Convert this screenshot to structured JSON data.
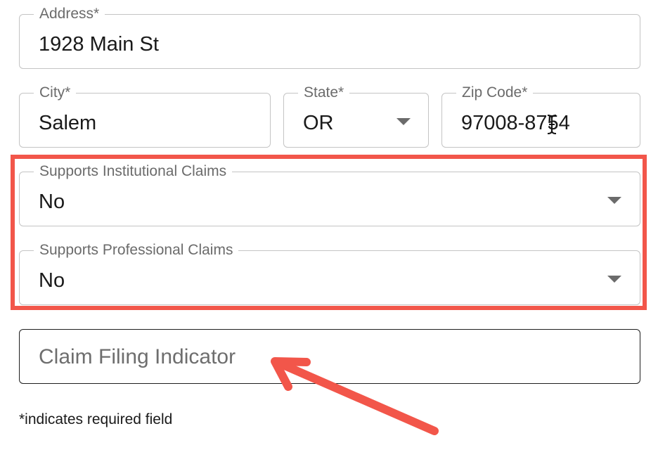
{
  "address": {
    "label": "Address*",
    "value": "1928 Main St"
  },
  "city": {
    "label": "City*",
    "value": "Salem"
  },
  "state": {
    "label": "State*",
    "value": "OR"
  },
  "zip": {
    "label": "Zip Code*",
    "value": "97008-8754"
  },
  "institutional": {
    "label": "Supports Institutional Claims",
    "value": "No"
  },
  "professional": {
    "label": "Supports Professional Claims",
    "value": "No"
  },
  "claim_filing": {
    "placeholder": "Claim Filing Indicator"
  },
  "footer": {
    "required_note": "*indicates required field"
  },
  "colors": {
    "annotation": "#f2564a",
    "field_border": "#c4c4c4",
    "focused_border": "#1f1f1f",
    "label_text": "#6b6b6b"
  },
  "icons": [
    "dropdown-caret-icon",
    "text-cursor-icon",
    "annotation-arrow-icon"
  ]
}
